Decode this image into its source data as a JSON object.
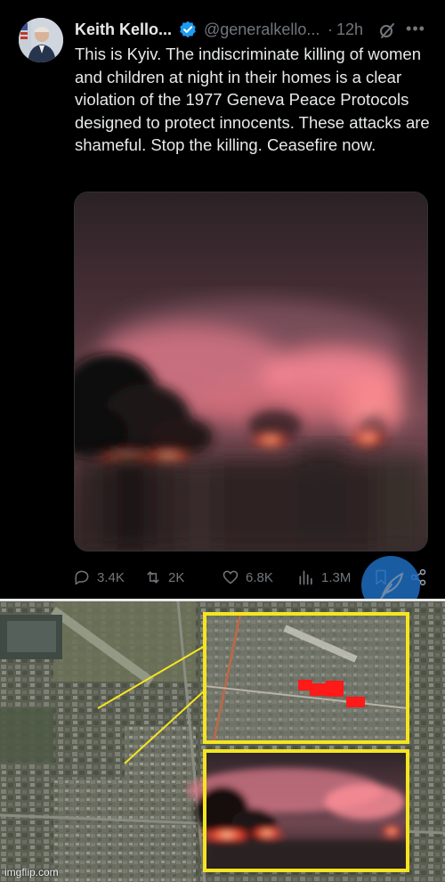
{
  "tweet": {
    "author_name": "Keith Kello...",
    "handle": "@generalkello...",
    "separator": "·",
    "time": "12h",
    "text": "This is Kyiv. The indiscriminate killing of women and children at night in their homes is a clear violation of the 1977 Geneva Peace Protocols designed to protect innocents. These attacks are shameful. Stop the killing. Ceasefire now.",
    "icons": {
      "verified": "verified-badge-icon",
      "grok": "grok-icon",
      "more": "more-options-icon",
      "reply": "reply-icon",
      "retweet": "retweet-icon",
      "like": "like-icon",
      "views": "views-icon",
      "bookmark": "bookmark-icon",
      "share": "share-icon"
    },
    "stats": {
      "replies": "3.4K",
      "retweets": "2K",
      "likes": "6.8K",
      "views": "1.3M"
    },
    "more_label": "•••"
  },
  "colors": {
    "background": "#000000",
    "text": "#e7e9ea",
    "muted": "#71767b",
    "verified": "#1d9bf0",
    "highlight_box": "#f5e51f",
    "marker": "#ff1a1a"
  },
  "watermark": "imgflip.com"
}
